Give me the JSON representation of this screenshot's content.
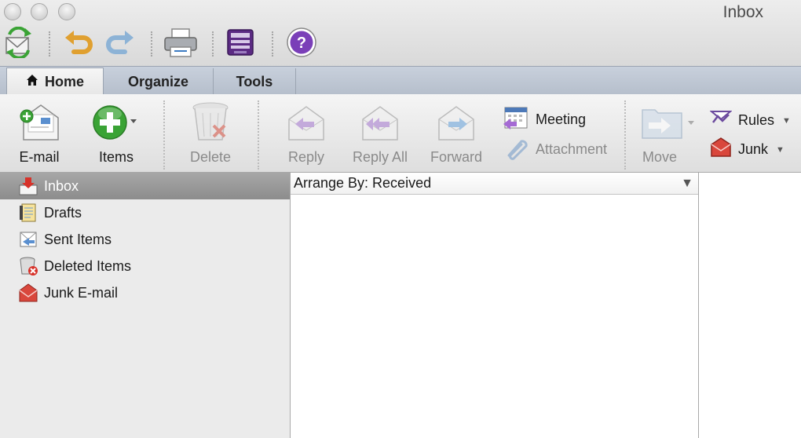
{
  "window": {
    "title": "Inbox"
  },
  "quick_toolbar": {
    "icons": [
      "send-receive-icon",
      "undo-icon",
      "redo-icon",
      "print-icon",
      "address-book-icon",
      "help-icon"
    ]
  },
  "tabs": [
    {
      "label": "Home",
      "active": true
    },
    {
      "label": "Organize",
      "active": false
    },
    {
      "label": "Tools",
      "active": false
    }
  ],
  "ribbon": {
    "email_label": "E-mail",
    "items_label": "Items",
    "delete_label": "Delete",
    "reply_label": "Reply",
    "reply_all_label": "Reply All",
    "forward_label": "Forward",
    "meeting_label": "Meeting",
    "attachment_label": "Attachment",
    "move_label": "Move",
    "rules_label": "Rules",
    "junk_label": "Junk"
  },
  "sidebar": {
    "folders": [
      {
        "label": "Inbox",
        "icon": "inbox-icon",
        "selected": true
      },
      {
        "label": "Drafts",
        "icon": "drafts-icon",
        "selected": false
      },
      {
        "label": "Sent Items",
        "icon": "sent-items-icon",
        "selected": false
      },
      {
        "label": "Deleted Items",
        "icon": "deleted-items-icon",
        "selected": false
      },
      {
        "label": "Junk E-mail",
        "icon": "junk-email-icon",
        "selected": false
      }
    ]
  },
  "message_list": {
    "arrange_by": "Arrange By: Received"
  },
  "colors": {
    "accent_green": "#3aa335",
    "help_purple": "#7a3fb8",
    "selection_gray": "#9a9a9a"
  }
}
